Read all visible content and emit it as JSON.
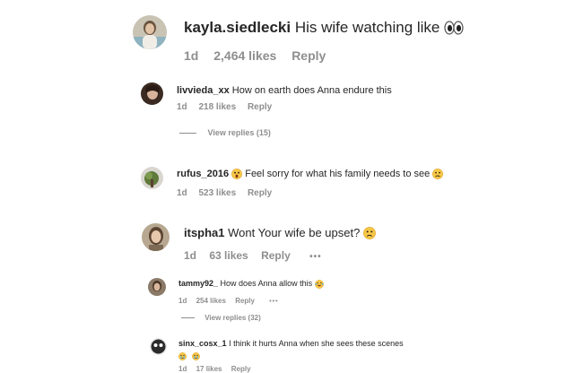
{
  "colors": {
    "text": "#262626",
    "muted": "#8e8e8e",
    "emoji_face": "#f7c948",
    "emoji_face_dark": "#e0a020"
  },
  "comments": [
    {
      "username": "kayla.siedlecki",
      "text": "His wife watching like",
      "emoji": "eyes-emoji",
      "time": "1d",
      "likes": "2,464 likes",
      "reply": "Reply",
      "avatar": "avatar-photo"
    },
    {
      "username": "livvieda_xx",
      "text": "How on earth does Anna endure this",
      "time": "1d",
      "likes": "218 likes",
      "reply": "Reply",
      "view_replies": "View replies (15)",
      "avatar": "avatar-photo"
    },
    {
      "username": "rufus_2016",
      "emoji_before": "astonished-face-emoji",
      "text": "Feel sorry for what his family needs to see",
      "emoji": "frowning-face-emoji",
      "time": "1d",
      "likes": "523 likes",
      "reply": "Reply",
      "avatar": "avatar-photo"
    },
    {
      "username": "itspha1",
      "text": "Wont Your wife be upset?",
      "emoji": "frowning-face-emoji",
      "time": "1d",
      "likes": "63 likes",
      "reply": "Reply",
      "more": "•••",
      "avatar": "avatar-photo"
    },
    {
      "username": "tammy92_",
      "text": "How does Anna allow this",
      "emoji": "laughing-tears-emoji",
      "time": "1d",
      "likes": "254 likes",
      "reply": "Reply",
      "more": "•••",
      "view_replies": "View replies (32)",
      "avatar": "avatar-photo"
    },
    {
      "username": "sinx_cosx_1",
      "text": "I think it hurts Anna when she sees these scenes",
      "emoji_line2": [
        "crying-face-emoji",
        "crying-face-emoji"
      ],
      "time": "1d",
      "likes": "17 likes",
      "reply": "Reply",
      "avatar": "avatar-photo"
    }
  ]
}
